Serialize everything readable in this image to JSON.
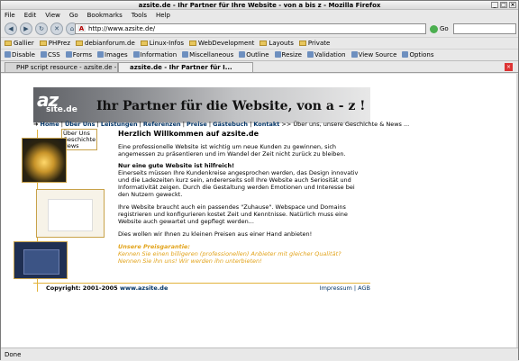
{
  "window": {
    "title": "azsite.de - Ihr Partner für Ihre Website - von a bis z - Mozilla Firefox"
  },
  "menu": [
    "File",
    "Edit",
    "View",
    "Go",
    "Bookmarks",
    "Tools",
    "Help"
  ],
  "nav": {
    "url": "http://www.azsite.de/",
    "go_label": "Go"
  },
  "bookmarks": [
    "Gallier",
    "PHPrez",
    "debianforum.de",
    "Linux-Infos",
    "WebDevelopment",
    "Layouts",
    "Private"
  ],
  "devbar": [
    "Disable",
    "CSS",
    "Forms",
    "Images",
    "Information",
    "Miscellaneous",
    "Outline",
    "Resize",
    "Validation",
    "View Source",
    "Options"
  ],
  "tabs": [
    {
      "label": "PHP script resource - azsite.de - ..."
    },
    {
      "label": "azsite.de - Ihr Partner für I..."
    }
  ],
  "page": {
    "banner_title": "Ihr Partner für die Website, von a - z !",
    "logo_text": "az",
    "logo_subtext": "site.de",
    "nav_items": [
      "Home",
      "Über Uns",
      "Leistungen",
      "Referenzen",
      "Preise",
      "Gästebuch",
      "Kontakt"
    ],
    "breadcrumb": ">> Über uns, unsere Geschichte & News ...",
    "submenu": [
      "Über Uns",
      "Geschichte",
      "News"
    ],
    "heading": "Herzlich Willkommen auf azsite.de",
    "p1": "Eine professionelle Website ist wichtig um neue Kunden zu gewinnen, sich angemessen zu präsentieren und im Wandel der Zeit nicht zurück zu bleiben.",
    "p2_title": "Nur eine gute Website ist hilfreich!",
    "p2": "Einerseits müssen Ihre Kundenkreise angesprochen werden, das Design innovativ und die Ladezeiten kurz sein, andererseits soll Ihre Website auch Seriosität und Informativität zeigen. Durch die Gestaltung werden Emotionen und Interesse bei den Nutzern geweckt.",
    "p3": "Ihre Website braucht auch ein passendes \"Zuhause\". Webspace und Domains registrieren und konfigurieren kostet Zeit und Kenntnisse. Natürlich muss eine Website auch gewartet und gepflegt werden...",
    "p4": "Dies wollen wir Ihnen zu kleinen Preisen aus einer Hand anbieten!",
    "guarantee_title": "Unsere Preisgarantie:",
    "guarantee_l1": "Kennen Sie einen billigeren (professionellen) Anbieter mit gleicher Qualität?",
    "guarantee_l2": "Nennen Sie ihn uns! Wir werden ihn unterbieten!",
    "copyright": "Copyright: 2001-2005",
    "copyright_link": "www.azsite.de",
    "impressum": "Impressum",
    "agb": "AGB"
  },
  "status": "Done"
}
